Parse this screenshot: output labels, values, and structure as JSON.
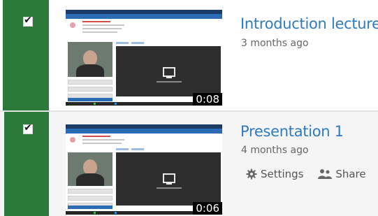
{
  "recordings": [
    {
      "title": "Introduction lecture",
      "age": "3 months ago",
      "duration": "0:08",
      "checked": "✔"
    },
    {
      "title": "Presentation 1",
      "age": "4 months ago",
      "duration": "0:06",
      "checked": "✔"
    }
  ],
  "actions": {
    "settings_label": "Settings",
    "share_label": "Share"
  },
  "colors": {
    "accent": "#2f7bbf",
    "selected_bg": "#2c7a3a"
  }
}
